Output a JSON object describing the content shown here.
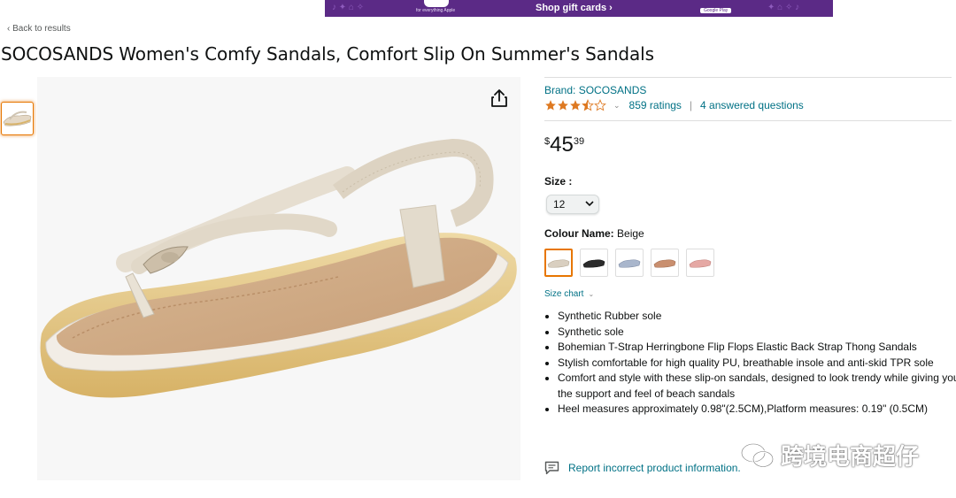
{
  "banner": {
    "cta": "Shop gift cards ›",
    "left_caption": "for everything Apple",
    "right_caption": "Google Play"
  },
  "nav": {
    "back_link": "‹ Back to results"
  },
  "product": {
    "title": "SOCOSANDS Women's Comfy Sandals, Comfort Slip On Summer's Sandals",
    "brand": "Brand: SOCOSANDS",
    "rating_value": 3.5,
    "ratings_count": "859 ratings",
    "answered_questions": "4 answered questions",
    "price": {
      "symbol": "$",
      "whole": "45",
      "fraction": "39"
    },
    "size_label": "Size :",
    "size_value": "12",
    "colour_label": "Colour Name:",
    "colour_value": "Beige",
    "swatches": [
      {
        "name": "Beige",
        "color": "#d9cfc0"
      },
      {
        "name": "Black",
        "color": "#2b2b2b"
      },
      {
        "name": "Blue",
        "color": "#a9b6cc"
      },
      {
        "name": "Brown",
        "color": "#c98f6f"
      },
      {
        "name": "Pink",
        "color": "#e5a8a4"
      }
    ],
    "size_chart": "Size chart",
    "features": [
      "Synthetic Rubber sole",
      "Synthetic sole",
      "Bohemian T-Strap Herringbone Flip Flops Elastic Back Strap Thong Sandals",
      "Stylish comfortable for high quality PU, breathable insole and anti-skid TPR sole",
      "Comfort and style with these slip-on sandals, designed to look trendy while giving you the support and feel of beach sandals",
      "Heel measures approximately 0.98\"(2.5CM),Platform measures: 0.19\" (0.5CM)"
    ],
    "report_link": "Report incorrect product information."
  },
  "watermark": {
    "text": "跨境电商超仔"
  },
  "colors": {
    "link": "#007185",
    "star": "#de7921",
    "selected": "#e77600",
    "banner": "#5b2a86"
  },
  "icons": [
    "share-icon",
    "star-icon",
    "chevron-down-icon",
    "report-icon",
    "wechat-icon"
  ]
}
